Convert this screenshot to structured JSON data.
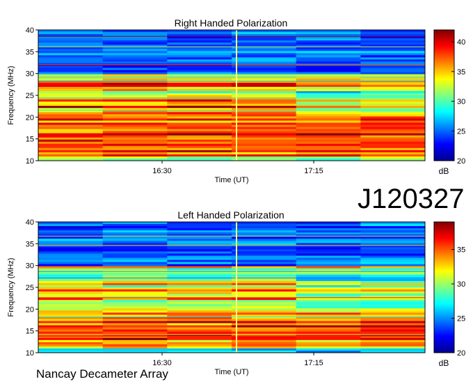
{
  "observation_id": "J120327",
  "instrument": "Nancay Decameter Array",
  "chart_data": [
    {
      "type": "heatmap",
      "title": "Right Handed Polarization",
      "xlabel": "Time (UT)",
      "ylabel": "Frequency (MHz)",
      "xticks": [
        "16:30",
        "17:15"
      ],
      "ylim": [
        10,
        40
      ],
      "yticks": [
        10,
        15,
        20,
        25,
        30,
        35,
        40
      ],
      "colorbar": {
        "label": "dB",
        "range": [
          20,
          42
        ],
        "ticks": [
          20,
          25,
          30,
          35,
          40
        ]
      },
      "colormap": "jet",
      "colormap_stops": [
        "#00008f",
        "#0000ff",
        "#0080ff",
        "#00ffff",
        "#80ff80",
        "#ffff00",
        "#ff8000",
        "#ff0000",
        "#800000"
      ],
      "marker_line_color": "#ffff80"
    },
    {
      "type": "heatmap",
      "title": "Left Handed Polarization",
      "xlabel": "Time (UT)",
      "ylabel": "Frequency (MHz)",
      "xticks": [
        "16:30",
        "17:15"
      ],
      "ylim": [
        10,
        40
      ],
      "yticks": [
        10,
        15,
        20,
        25,
        30,
        35,
        40
      ],
      "colorbar": {
        "label": "dB",
        "range": [
          20,
          39
        ],
        "ticks": [
          20,
          25,
          30,
          35
        ]
      },
      "colormap": "jet",
      "colormap_stops": [
        "#00008f",
        "#0000ff",
        "#0080ff",
        "#00ffff",
        "#80ff80",
        "#ffff00",
        "#ff8000",
        "#ff0000",
        "#800000"
      ],
      "marker_line_color": "#ffff80"
    }
  ]
}
